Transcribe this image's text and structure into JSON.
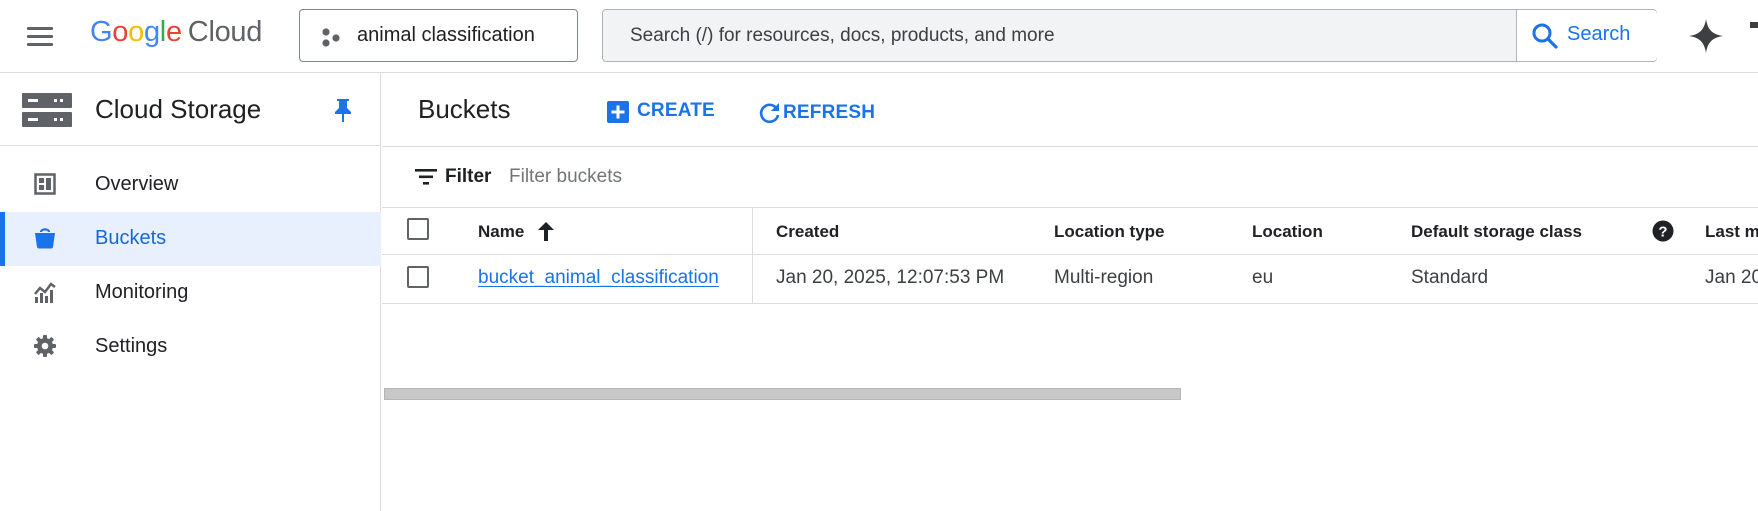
{
  "header": {
    "logo": {
      "google": "Google",
      "cloud": "Cloud"
    },
    "project": {
      "name": "animal classification"
    },
    "search": {
      "placeholder": "Search (/) for resources, docs, products, and more",
      "button_label": "Search"
    },
    "icons": [
      "menu-icon",
      "project-icon",
      "search-icon",
      "gemini-icon"
    ]
  },
  "sidebar": {
    "product_title": "Cloud Storage",
    "items": [
      {
        "label": "Overview",
        "icon": "overview-icon",
        "active": false
      },
      {
        "label": "Buckets",
        "icon": "bucket-icon",
        "active": true
      },
      {
        "label": "Monitoring",
        "icon": "monitoring-icon",
        "active": false
      },
      {
        "label": "Settings",
        "icon": "gear-icon",
        "active": false
      }
    ]
  },
  "main": {
    "title": "Buckets",
    "actions": {
      "create": "CREATE",
      "refresh": "REFRESH"
    },
    "filter": {
      "label": "Filter",
      "placeholder": "Filter buckets"
    },
    "table": {
      "columns": [
        "Name",
        "Created",
        "Location type",
        "Location",
        "Default storage class",
        "Last m"
      ],
      "sort": {
        "column": "Name",
        "direction": "ascending"
      },
      "rows": [
        {
          "name": "bucket_animal_classification",
          "created": "Jan 20, 2025, 12:07:53 PM",
          "location_type": "Multi-region",
          "location": "eu",
          "storage_class": "Standard",
          "last_modified": "Jan 20"
        }
      ]
    }
  },
  "colors": {
    "accent": "#1a73e8",
    "active_bg": "#e8f0fe",
    "border": "#dadce0"
  }
}
